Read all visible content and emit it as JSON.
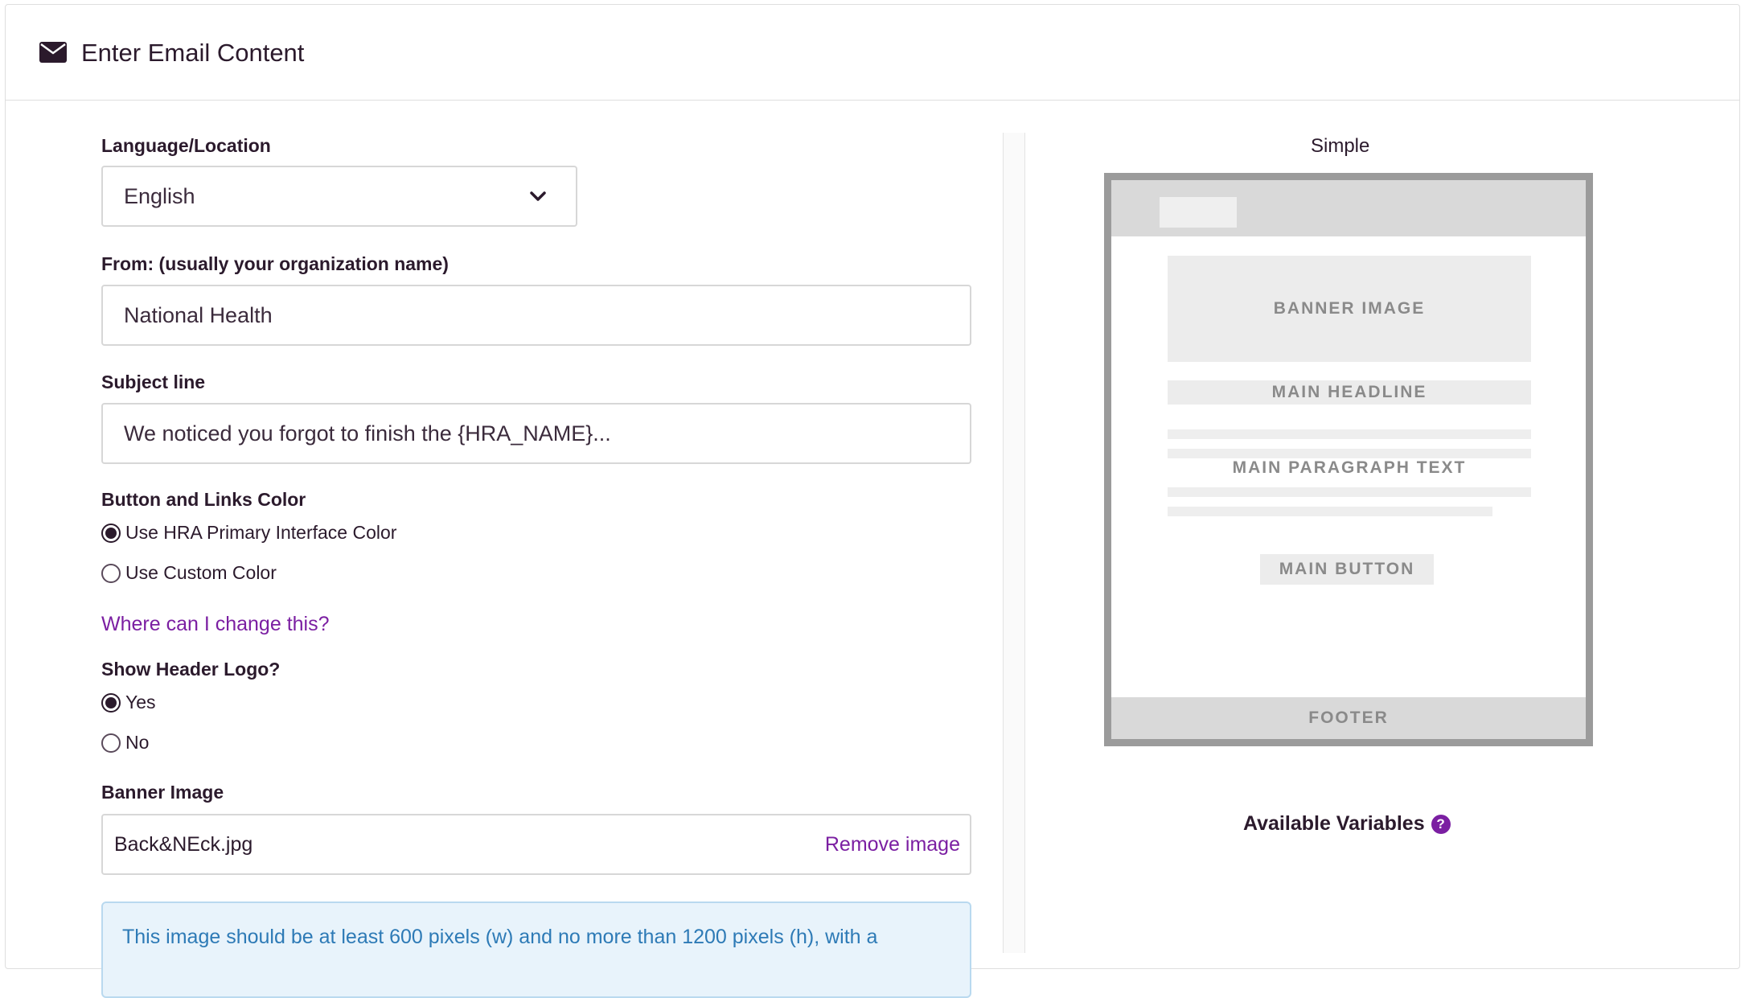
{
  "header": {
    "title": "Enter Email Content",
    "icon": "envelope-icon"
  },
  "form": {
    "language": {
      "label": "Language/Location",
      "value": "English"
    },
    "from": {
      "label": "From: (usually your organization name)",
      "value": "National Health"
    },
    "subject": {
      "label": "Subject line",
      "value": "We noticed you forgot to finish the {HRA_NAME}..."
    },
    "button_color": {
      "label": "Button and Links Color",
      "options": [
        "Use HRA Primary Interface Color",
        "Use Custom Color"
      ],
      "selected": "Use HRA Primary Interface Color"
    },
    "change_link": "Where can I change this?",
    "header_logo": {
      "label": "Show Header Logo?",
      "options": [
        "Yes",
        "No"
      ],
      "selected": "Yes"
    },
    "banner": {
      "label": "Banner Image",
      "filename": "Back&NEck.jpg",
      "remove_label": "Remove image"
    },
    "info_text": "This image should be at least 600 pixels (w) and no more than 1200 pixels (h), with a"
  },
  "preview": {
    "title": "Simple",
    "banner": "BANNER IMAGE",
    "headline": "MAIN HEADLINE",
    "paragraph": "MAIN PARAGRAPH TEXT",
    "button": "MAIN BUTTON",
    "footer": "FOOTER"
  },
  "variables": {
    "label": "Available Variables",
    "help_glyph": "?"
  },
  "colors": {
    "accent": "#7b1fa2",
    "text": "#2b1a2c",
    "info_bg": "#e8f3fb",
    "info_text": "#2d7ab6"
  }
}
